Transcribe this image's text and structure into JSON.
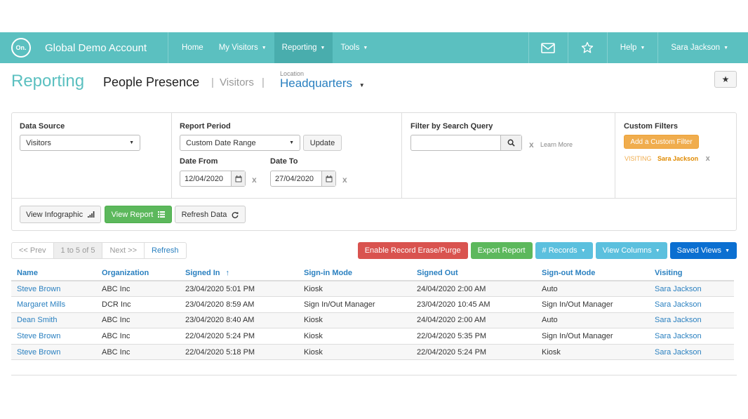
{
  "nav": {
    "logo": "On.",
    "account": "Global Demo Account",
    "items": [
      {
        "label": "Home"
      },
      {
        "label": "My Visitors"
      },
      {
        "label": "Reporting"
      },
      {
        "label": "Tools"
      }
    ],
    "help": "Help",
    "user": "Sara Jackson"
  },
  "title": {
    "section": "Reporting",
    "page": "People Presence",
    "sep": "|",
    "alt_page": "Visitors",
    "location_label": "Location",
    "location_value": "Headquarters"
  },
  "filters": {
    "data_source_label": "Data Source",
    "data_source_value": "Visitors",
    "report_period_label": "Report Period",
    "report_period_value": "Custom Date Range",
    "update_label": "Update",
    "date_from_label": "Date From",
    "date_from_value": "12/04/2020",
    "date_to_label": "Date To",
    "date_to_value": "27/04/2020",
    "clear": "x",
    "search_label": "Filter by Search Query",
    "search_placeholder": "",
    "learn_more": "Learn More",
    "custom_label": "Custom Filters",
    "add_custom": "Add a Custom Filter",
    "visiting_tag": "VISITING",
    "visiting_value": "Sara Jackson",
    "view_infographic": "View Infographic",
    "view_report": "View Report",
    "refresh_data": "Refresh Data"
  },
  "pager": {
    "prev": "<< Prev",
    "range": "1 to 5 of 5",
    "next": "Next >>",
    "refresh": "Refresh"
  },
  "actions": {
    "erase": "Enable Record Erase/Purge",
    "export": "Export Report",
    "records": "# Records",
    "columns": "View Columns",
    "saved": "Saved Views"
  },
  "table": {
    "headers": [
      "Name",
      "Organization",
      "Signed In",
      "Sign-in Mode",
      "Signed Out",
      "Sign-out Mode",
      "Visiting"
    ],
    "sort_arrow": "↑",
    "rows": [
      [
        "Steve Brown",
        "ABC Inc",
        "23/04/2020 5:01 PM",
        "Kiosk",
        "24/04/2020 2:00 AM",
        "Auto",
        "Sara Jackson"
      ],
      [
        "Margaret Mills",
        "DCR Inc",
        "23/04/2020 8:59 AM",
        "Sign In/Out Manager",
        "23/04/2020 10:45 AM",
        "Sign In/Out Manager",
        "Sara Jackson"
      ],
      [
        "Dean Smith",
        "ABC Inc",
        "23/04/2020 8:40 AM",
        "Kiosk",
        "24/04/2020 2:00 AM",
        "Auto",
        "Sara Jackson"
      ],
      [
        "Steve Brown",
        "ABC Inc",
        "22/04/2020 5:24 PM",
        "Kiosk",
        "22/04/2020 5:35 PM",
        "Sign In/Out Manager",
        "Sara Jackson"
      ],
      [
        "Steve Brown",
        "ABC Inc",
        "22/04/2020 5:18 PM",
        "Kiosk",
        "22/04/2020 5:24 PM",
        "Kiosk",
        "Sara Jackson"
      ]
    ]
  },
  "colors": {
    "brand": "#5bc0c0",
    "link": "#2a80c0"
  }
}
